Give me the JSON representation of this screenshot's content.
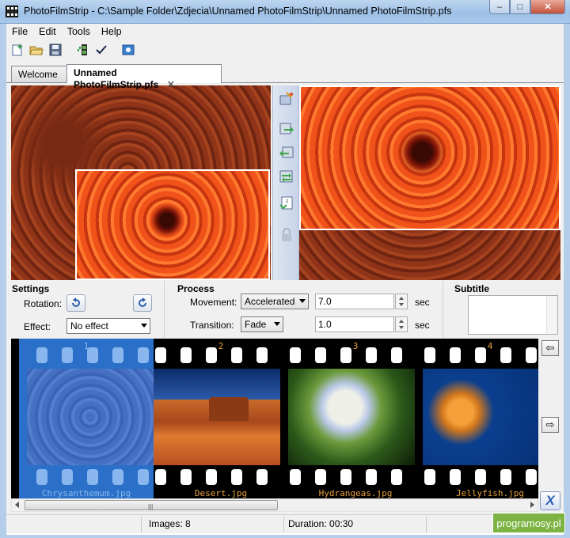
{
  "window": {
    "title": "PhotoFilmStrip - C:\\Sample Folder\\Zdjecia\\Unnamed PhotoFilmStrip\\Unnamed PhotoFilmStrip.pfs",
    "minimize_glyph": "–",
    "maximize_glyph": "□",
    "close_glyph": "✕"
  },
  "menu": [
    "File",
    "Edit",
    "Tools",
    "Help"
  ],
  "toolbar": {
    "icons": [
      "new-project-icon",
      "open-project-icon",
      "save-project-icon",
      "import-pictures-icon",
      "check-icon",
      "render-icon"
    ]
  },
  "tabs": [
    {
      "label": "Welcome",
      "active": false
    },
    {
      "label": "Unnamed PhotoFilmStrip.pfs",
      "active": true,
      "close": "✕"
    }
  ],
  "side_tools": [
    "magic-wand-icon",
    "copy-right-icon",
    "copy-left-icon",
    "swap-icon",
    "totally-random-icon",
    "lock-icon"
  ],
  "settings": {
    "title": "Settings",
    "rotation_label": "Rotation:",
    "effect_label": "Effect:",
    "effect_value": "No effect"
  },
  "process": {
    "title": "Process",
    "movement_label": "Movement:",
    "movement_value": "Accelerated",
    "movement_duration": "7.0",
    "transition_label": "Transition:",
    "transition_value": "Fade",
    "transition_duration": "1.0",
    "unit": "sec"
  },
  "subtitle": {
    "title": "Subtitle",
    "value": ""
  },
  "filmstrip": [
    {
      "num": "1",
      "name": "Chrysanthemum.jpg",
      "selected": true,
      "kind": "chrys"
    },
    {
      "num": "2",
      "name": "Desert.jpg",
      "selected": false,
      "kind": "desert"
    },
    {
      "num": "3",
      "name": "Hydrangeas.jpg",
      "selected": false,
      "kind": "hydr"
    },
    {
      "num": "4",
      "name": "Jellyfish.jpg",
      "selected": false,
      "kind": "jelly"
    }
  ],
  "strip_buttons": {
    "move_left": "⇦",
    "move_right": "⇨",
    "remove": "X",
    "scroll_grip": "|||"
  },
  "statusbar": {
    "images": "Images: 8",
    "duration": "Duration: 00:30"
  },
  "watermark": "programosy.pl",
  "colors": {
    "accent_selected_frame": "#2a70c8",
    "frame_label": "#e8a23a",
    "watermark_bg": "#7cb342"
  }
}
